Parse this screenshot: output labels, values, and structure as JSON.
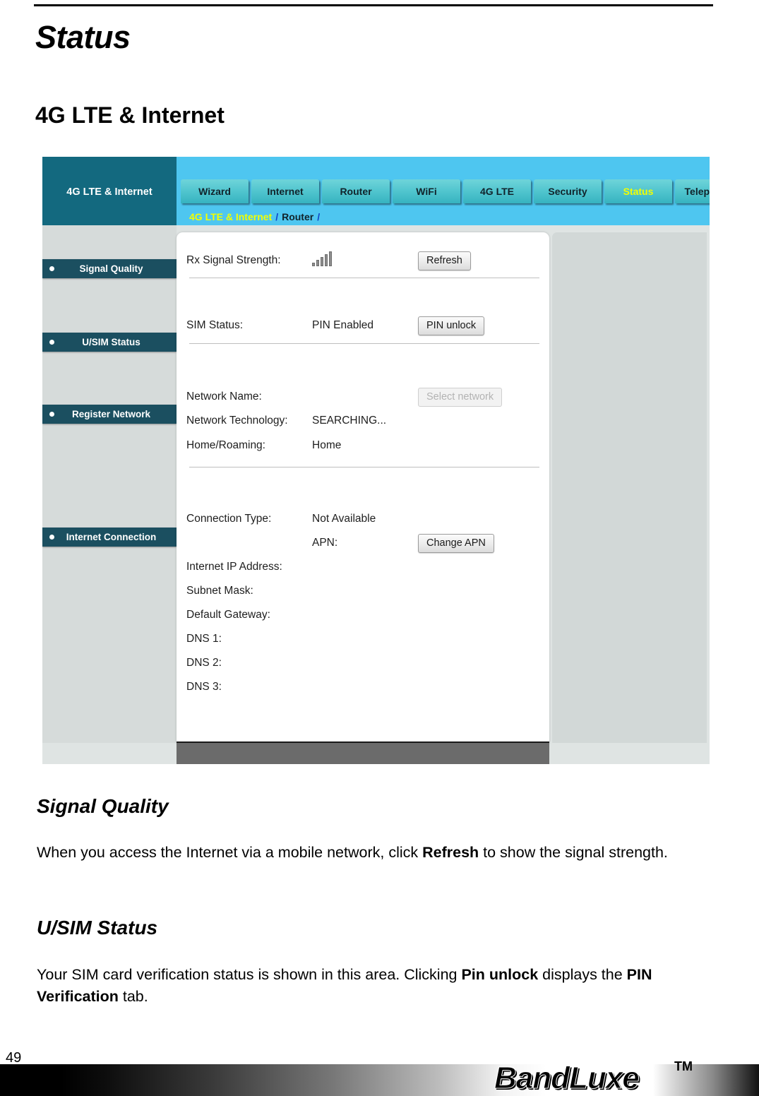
{
  "document": {
    "title": "Status",
    "subtitle": "4G LTE & Internet",
    "page_number": "49"
  },
  "screenshot": {
    "brand_label": "4G LTE & Internet",
    "tabs": [
      {
        "label": "Wizard",
        "active": false
      },
      {
        "label": "Internet",
        "active": false
      },
      {
        "label": "Router",
        "active": false
      },
      {
        "label": "WiFi",
        "active": false
      },
      {
        "label": "4G LTE",
        "active": false
      },
      {
        "label": "Security",
        "active": false
      },
      {
        "label": "Status",
        "active": true
      },
      {
        "label": "Telephony",
        "active": false
      }
    ],
    "breadcrumb": {
      "root": "4G LTE & Internet",
      "sep1": "/",
      "current": "Router",
      "sep2": "/"
    },
    "menu_items": [
      {
        "label": "Signal Quality",
        "selected": true
      },
      {
        "label": "U/SIM Status",
        "selected": false
      },
      {
        "label": "Register Network",
        "selected": false
      },
      {
        "label": "Internet Connection",
        "selected": false
      }
    ],
    "fields": {
      "rx_signal_label": "Rx Signal Strength:",
      "refresh_button": "Refresh",
      "sim_status_label": "SIM Status:",
      "sim_status_value": "PIN Enabled",
      "pin_unlock_button": "PIN unlock",
      "network_name_label": "Network Name:",
      "network_name_value": "",
      "select_network_button": "Select network",
      "network_tech_label": "Network Technology:",
      "network_tech_value": "SEARCHING...",
      "home_roaming_label": "Home/Roaming:",
      "home_roaming_value": "Home",
      "connection_type_label": "Connection Type:",
      "connection_type_value": "Not Available",
      "apn_label": "APN:",
      "apn_value": "",
      "change_apn_button": "Change APN",
      "internet_ip_label": "Internet IP Address:",
      "internet_ip_value": "",
      "subnet_mask_label": "Subnet Mask:",
      "subnet_mask_value": "",
      "default_gateway_label": "Default Gateway:",
      "default_gateway_value": "",
      "dns1_label": "DNS 1:",
      "dns1_value": "",
      "dns2_label": "DNS 2:",
      "dns2_value": "",
      "dns3_label": "DNS 3:",
      "dns3_value": ""
    },
    "signal_icon": {
      "name": "signal-strength-icon",
      "bars": 5
    },
    "colors": {
      "brand_teal": "#13697f",
      "tab_blue": "#4ec6f0",
      "tab_teal": "#53c6cf",
      "active_tab_text": "#f2ff00",
      "menu_dark": "#1b4f60",
      "breadcrumb_sep": "#1046c8"
    }
  },
  "sections": [
    {
      "heading": "Signal Quality",
      "body_parts": [
        {
          "text": "When you access the Internet via a mobile network, click ",
          "bold": false
        },
        {
          "text": "Refresh",
          "bold": true
        },
        {
          "text": " to show the signal strength.",
          "bold": false
        }
      ]
    },
    {
      "heading": "U/SIM Status",
      "body_parts": [
        {
          "text": "Your SIM card verification status is shown in this area. Clicking ",
          "bold": false
        },
        {
          "text": "Pin unlock",
          "bold": true
        },
        {
          "text": " displays the ",
          "bold": false
        },
        {
          "text": "PIN Verification",
          "bold": true
        },
        {
          "text": " tab.",
          "bold": false
        }
      ]
    }
  ],
  "footer": {
    "logo_text": "BandLuxe",
    "trademark": "TM"
  }
}
